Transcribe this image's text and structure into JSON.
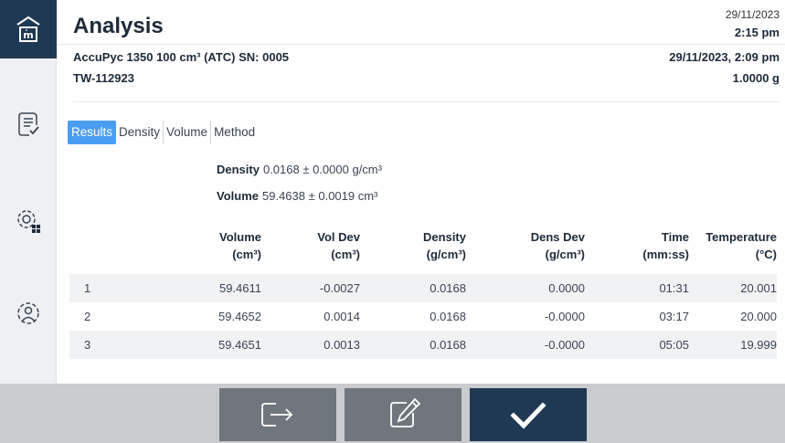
{
  "header": {
    "title": "Analysis",
    "current_date": "29/11/2023",
    "current_time": "2:15 pm"
  },
  "info": {
    "instrument": "AccuPyc 1350 100 cm³ (ATC) SN: 0005",
    "sample_id": "TW-112923",
    "run_datetime": "29/11/2023, 2:09 pm",
    "mass": "1.0000 g"
  },
  "tabs": [
    {
      "label": "Results",
      "active": true
    },
    {
      "label": "Density",
      "active": false
    },
    {
      "label": "Volume",
      "active": false
    },
    {
      "label": "Method",
      "active": false
    }
  ],
  "summary": {
    "density_label": "Density",
    "density_value": "0.0168 ± 0.0000 g/cm³",
    "volume_label": "Volume",
    "volume_value": "59.4638 ± 0.0019 cm³"
  },
  "table": {
    "columns": [
      {
        "name": "",
        "unit": ""
      },
      {
        "name": "Volume",
        "unit": "(cm³)"
      },
      {
        "name": "Vol Dev",
        "unit": "(cm³)"
      },
      {
        "name": "Density",
        "unit": "(g/cm³)"
      },
      {
        "name": "Dens Dev",
        "unit": "(g/cm³)"
      },
      {
        "name": "Time",
        "unit": "(mm:ss)"
      },
      {
        "name": "Temperature",
        "unit": "(°C)"
      }
    ],
    "rows": [
      [
        "1",
        "59.4611",
        "-0.0027",
        "0.0168",
        "0.0000",
        "01:31",
        "20.001"
      ],
      [
        "2",
        "59.4652",
        "0.0014",
        "0.0168",
        "-0.0000",
        "03:17",
        "20.000"
      ],
      [
        "3",
        "59.4651",
        "0.0013",
        "0.0168",
        "-0.0000",
        "05:05",
        "19.999"
      ]
    ]
  },
  "sidebar": {
    "icons": [
      "home-icon",
      "report-checklist-icon",
      "settings-grid-icon",
      "user-settings-icon"
    ]
  },
  "footer": {
    "buttons": [
      "export-icon",
      "edit-icon",
      "confirm-checkmark-icon"
    ]
  },
  "colors": {
    "brand_dark": "#1f3854",
    "tab_active": "#4a9ef2",
    "footer_bg": "#c9cbcf",
    "button_gray": "#6f767d"
  }
}
